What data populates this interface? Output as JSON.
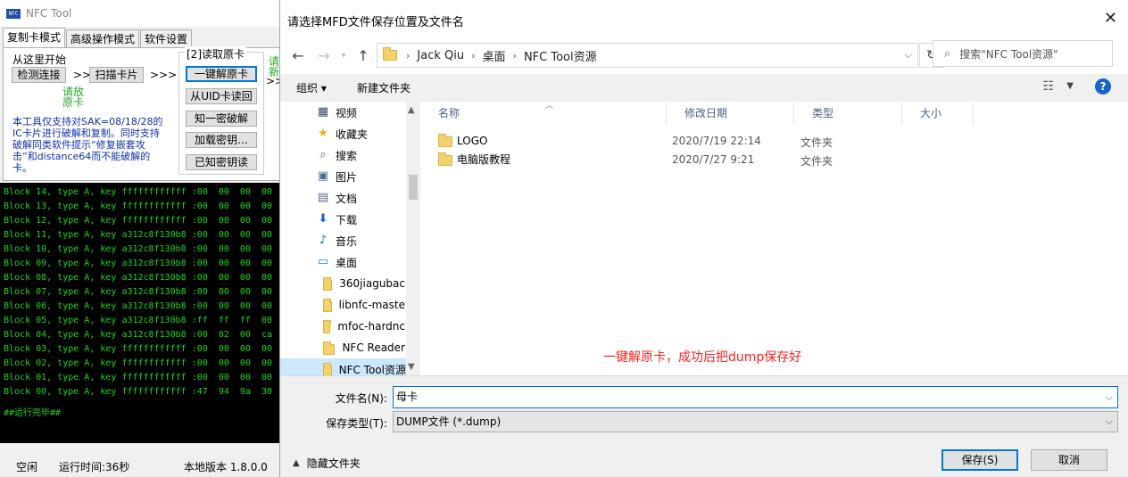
{
  "nfc": {
    "title": "NFC Tool",
    "tabs": [
      "复制卡模式",
      "高级操作模式",
      "软件设置"
    ],
    "start_label": "从这里开始",
    "detect_btn": "检测连接",
    "scan_btn": "扫描卡片",
    "arrows": ">>>",
    "place_card": "请放",
    "place_card2": "原卡",
    "description": "本工具仅支持对SAK=08/18/28的IC卡片进行破解和复制。同时支持破解同类软件提示“修复嵌套攻击”和distance64而不能破解的卡。",
    "group_title": "[2]读取原卡",
    "group_buttons": [
      "一键解原卡",
      "从UID卡读回",
      "知一密破解",
      "加载密钥…",
      "已知密钥读"
    ],
    "right_hint": "请",
    "right_hint2": "新",
    "console_lines": [
      "Block 14, type A, key ffffffffffff :00  00  00  00",
      "Block 13, type A, key ffffffffffff :00  00  00  00",
      "Block 12, type A, key ffffffffffff :00  00  00  00",
      "Block 11, type A, key a312c8f130b8 :00  00  00  00",
      "Block 10, type A, key a312c8f130b8 :00  00  00  00",
      "Block 09, type A, key a312c8f130b8 :00  00  00  00",
      "Block 08, type A, key a312c8f130b8 :00  00  00  00",
      "Block 07, type A, key a312c8f130b8 :00  00  00  00",
      "Block 06, type A, key a312c8f130b8 :00  00  00  00",
      "Block 05, type A, key a312c8f130b8 :ff  ff  ff  00",
      "Block 04, type A, key a312c8f130b8 :00  02  00  ca",
      "Block 03, type A, key ffffffffffff :00  00  00  00",
      "Block 02, type A, key ffffffffffff :00  00  00  00",
      "Block 01, type A, key ffffffffffff :00  00  00  00",
      "Block 00, type A, key ffffffffffff :47  94  9a  30"
    ],
    "console_done": "##运行完毕##",
    "status_idle": "空闲",
    "status_runtime": "运行时间:36秒",
    "status_version": "本地版本 1.8.0.0"
  },
  "dialog": {
    "title": "请选择MFD文件保存位置及文件名",
    "close": "✕",
    "breadcrumb": [
      "Jack Qiu",
      "桌面",
      "NFC Tool资源"
    ],
    "search_placeholder": "搜索\"NFC Tool资源\"",
    "organize": "组织 ▾",
    "new_folder": "新建文件夹",
    "help": "?",
    "tree": [
      {
        "label": "视频",
        "icon": "video-icon"
      },
      {
        "label": "收藏夹",
        "icon": "star-icon"
      },
      {
        "label": "搜索",
        "icon": "search-icon"
      },
      {
        "label": "图片",
        "icon": "picture-icon"
      },
      {
        "label": "文档",
        "icon": "document-icon"
      },
      {
        "label": "下载",
        "icon": "download-icon"
      },
      {
        "label": "音乐",
        "icon": "music-icon"
      },
      {
        "label": "桌面",
        "icon": "desktop-icon"
      },
      {
        "label": "360jiagubac",
        "icon": "folder-icon"
      },
      {
        "label": "libnfc-maste",
        "icon": "folder-icon"
      },
      {
        "label": "mfoc-hardnc",
        "icon": "folder-icon"
      },
      {
        "label": "NFC Reader",
        "icon": "folder-icon"
      },
      {
        "label": "NFC Tool资源",
        "icon": "folder-icon"
      }
    ],
    "columns": [
      "名称",
      "修改日期",
      "类型",
      "大小"
    ],
    "files": [
      {
        "name": "LOGO",
        "date": "2020/7/19 22:14",
        "type": "文件夹"
      },
      {
        "name": "电脑版教程",
        "date": "2020/7/27 9:21",
        "type": "文件夹"
      }
    ],
    "annotation": "一键解原卡，成功后把dump保存好",
    "filename_label": "文件名(N):",
    "filename_value": "母卡",
    "filetype_label": "保存类型(T):",
    "filetype_value": "DUMP文件 (*.dump)",
    "hide_folders": "隐藏文件夹",
    "save_btn": "保存(S)",
    "cancel_btn": "取消",
    "accent": "#0078d7"
  }
}
